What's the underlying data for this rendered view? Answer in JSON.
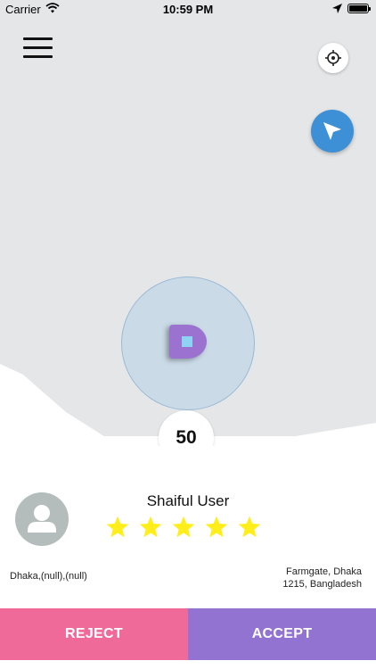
{
  "status_bar": {
    "carrier": "Carrier",
    "time": "10:59 PM",
    "icons": [
      "wifi-icon",
      "location-arrow-icon",
      "battery-icon"
    ]
  },
  "map": {
    "icons": [
      "menu-icon",
      "crosshair-icon",
      "navigation-arrow-icon",
      "driver-marker-icon"
    ],
    "accent_color": "#3d8fd6",
    "marker_color": "#9b72d0",
    "count": "50"
  },
  "request": {
    "user_name": "Shaiful User",
    "rating": 5,
    "rating_max": 5,
    "star_color": "#ffee1a",
    "avatar_icon": "user-avatar-icon",
    "pickup": "Dhaka,(null),(null)",
    "dropoff_line1": "Farmgate, Dhaka",
    "dropoff_line2": "1215, Bangladesh"
  },
  "actions": {
    "reject_label": "REJECT",
    "accept_label": "ACCEPT",
    "reject_color": "#f06a99",
    "accept_color": "#9373d2"
  }
}
